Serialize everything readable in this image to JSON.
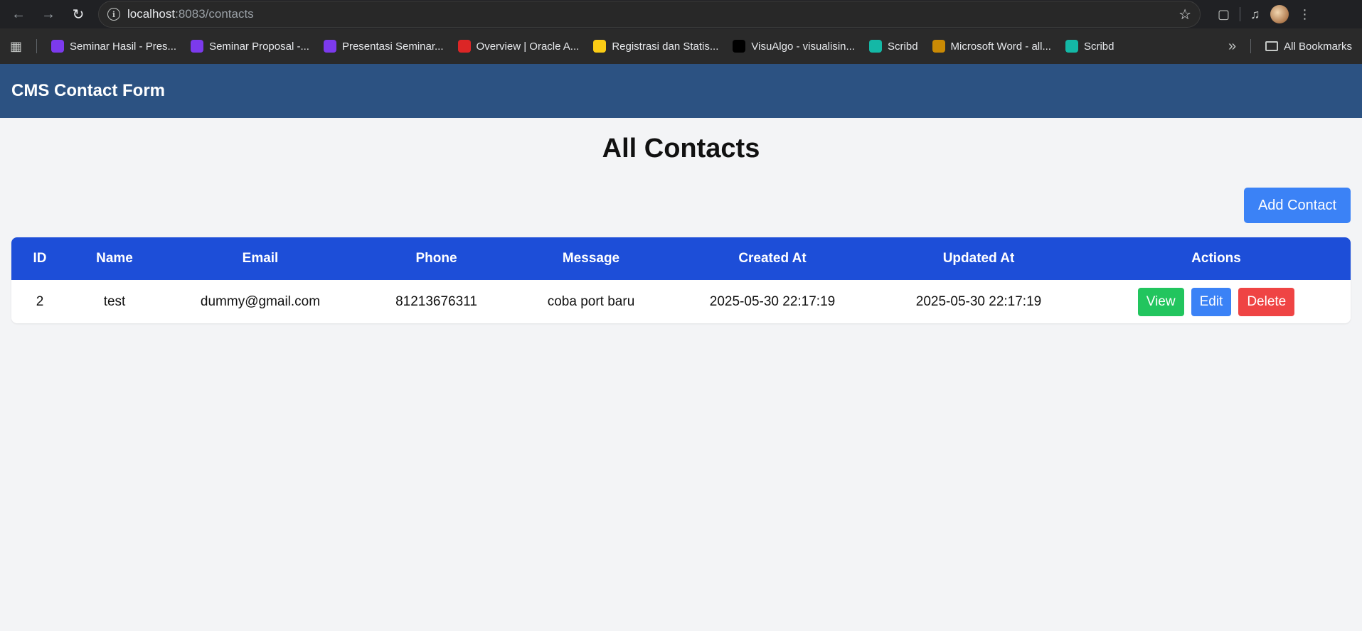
{
  "browser": {
    "url_host": "localhost",
    "url_path": ":8083/contacts",
    "bookmarks": [
      {
        "label": "Seminar Hasil - Pres...",
        "color": "#7c3aed"
      },
      {
        "label": "Seminar Proposal -...",
        "color": "#7c3aed"
      },
      {
        "label": "Presentasi Seminar...",
        "color": "#7c3aed"
      },
      {
        "label": "Overview | Oracle A...",
        "color": "#dc2626"
      },
      {
        "label": "Registrasi dan Statis...",
        "color": "#facc15"
      },
      {
        "label": "VisuAlgo - visualisin...",
        "color": "#000000"
      },
      {
        "label": "Scribd",
        "color": "#14b8a6"
      },
      {
        "label": "Microsoft Word - all...",
        "color": "#ca8a04"
      },
      {
        "label": "Scribd",
        "color": "#14b8a6"
      }
    ],
    "all_bookmarks_label": "All Bookmarks"
  },
  "app": {
    "title": "CMS Contact Form"
  },
  "page": {
    "title": "All Contacts",
    "add_button": "Add Contact"
  },
  "table": {
    "headers": [
      "ID",
      "Name",
      "Email",
      "Phone",
      "Message",
      "Created At",
      "Updated At",
      "Actions"
    ],
    "rows": [
      {
        "id": "2",
        "name": "test",
        "email": "dummy@gmail.com",
        "phone": "81213676311",
        "message": "coba port baru",
        "created_at": "2025-05-30 22:17:19",
        "updated_at": "2025-05-30 22:17:19"
      }
    ],
    "actions": {
      "view": "View",
      "edit": "Edit",
      "delete": "Delete"
    }
  },
  "colors": {
    "header_bg": "#2c5282",
    "table_header_bg": "#1d4ed8",
    "view": "#22c55e",
    "edit": "#3b82f6",
    "delete": "#ef4444"
  }
}
